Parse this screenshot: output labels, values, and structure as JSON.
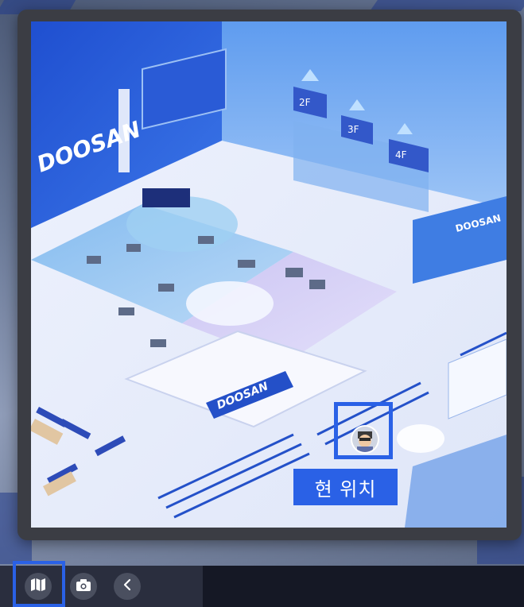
{
  "map": {
    "brand_text": "DOOSAN",
    "floor_signs": [
      "2F",
      "3F",
      "4F"
    ],
    "current_location_label": "현 위치"
  },
  "toolbar": {
    "buttons": [
      {
        "name": "map-button",
        "icon": "map-icon",
        "active": true
      },
      {
        "name": "camera-button",
        "icon": "camera-icon",
        "active": false
      },
      {
        "name": "back-button",
        "icon": "chevron-left-icon",
        "active": false
      }
    ]
  },
  "colors": {
    "accent": "#2a61e6",
    "toolbar_bg": "#151825",
    "toolbar_group_bg": "#2a2e3e",
    "button_bg": "#4a4f5f"
  }
}
